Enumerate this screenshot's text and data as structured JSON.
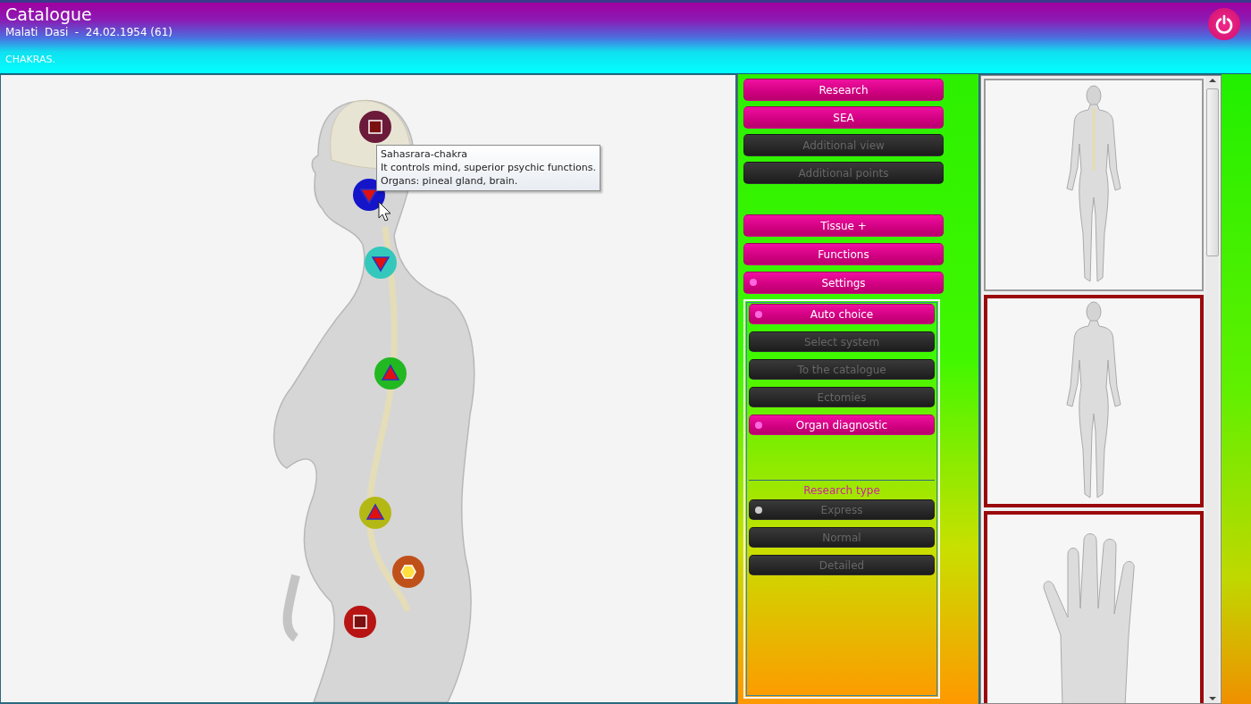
{
  "header": {
    "title": "Catalogue",
    "patient": "Malati  Dasi  -  24.02.1954 (61)",
    "section": "CHAKRAS."
  },
  "viewer": {
    "markers": [
      {
        "kind": "square",
        "color": "#6b1a3a"
      },
      {
        "kind": "triangle-down",
        "color": "#1414c8"
      },
      {
        "kind": "triangle-down",
        "color": "#34c8bc"
      },
      {
        "kind": "triangle-up",
        "color": "#22b822"
      },
      {
        "kind": "triangle-up",
        "color": "#b4b814"
      },
      {
        "kind": "hexagon",
        "color": "#c0501a"
      },
      {
        "kind": "square",
        "color": "#b81414"
      }
    ],
    "tooltip": {
      "title": "Sahasrara-chakra",
      "description": "It controls mind, superior psychic functions.",
      "organs": "Organs: pineal gland, brain."
    }
  },
  "menu_top": [
    {
      "label": "Research",
      "active": true,
      "selected": false
    },
    {
      "label": "SEA",
      "active": true,
      "selected": false
    },
    {
      "label": "Additional view",
      "active": false,
      "selected": false
    },
    {
      "label": "Additional points",
      "active": false,
      "selected": false
    }
  ],
  "menu_middle": [
    {
      "label": "Tissue +",
      "active": true,
      "selected": false
    },
    {
      "label": "Functions",
      "active": true,
      "selected": false
    },
    {
      "label": "Settings",
      "active": true,
      "selected": true
    }
  ],
  "settings_panel": {
    "options": [
      {
        "label": "Auto choice",
        "active": true,
        "selected": true
      },
      {
        "label": "Select system",
        "active": false,
        "selected": false
      },
      {
        "label": "To the catalogue",
        "active": false,
        "selected": false
      },
      {
        "label": "Ectomies",
        "active": false,
        "selected": false
      },
      {
        "label": "Organ diagnostic",
        "active": true,
        "selected": true
      }
    ],
    "research_type_label": "Research type",
    "research_types": [
      {
        "label": "Express",
        "active": false,
        "selected": true
      },
      {
        "label": "Normal",
        "active": false,
        "selected": false
      },
      {
        "label": "Detailed",
        "active": false,
        "selected": false
      }
    ]
  },
  "thumbnails": [
    {
      "kind": "back",
      "selected": false
    },
    {
      "kind": "front",
      "selected": true
    },
    {
      "kind": "hand",
      "selected": true
    }
  ]
}
